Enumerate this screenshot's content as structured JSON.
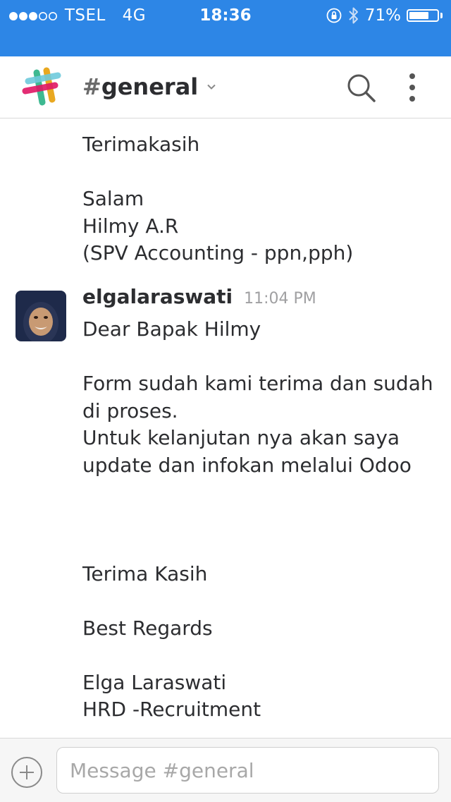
{
  "status_bar": {
    "carrier": "TSEL",
    "network": "4G",
    "time": "18:36",
    "battery_label": "71%",
    "battery_level": 0.71
  },
  "header": {
    "hash": "#",
    "channel": "general"
  },
  "messages": [
    {
      "text": "Terimakasih\n\nSalam\nHilmy A.R\n(SPV Accounting - ppn,pph)"
    },
    {
      "author": "elgalaraswati",
      "timestamp": "11:04 PM",
      "text": "Dear Bapak Hilmy\n\nForm sudah kami terima dan sudah di proses.\nUntuk kelanjutan nya akan saya update dan infokan melalui Odoo\n\n\n\nTerima Kasih\n\nBest Regards\n\nElga Laraswati\nHRD -Recruitment"
    }
  ],
  "composer": {
    "placeholder": "Message #general"
  },
  "colors": {
    "status_bar": "#2d86e6",
    "text": "#2c2d30",
    "timestamp": "#a0a0a2"
  }
}
